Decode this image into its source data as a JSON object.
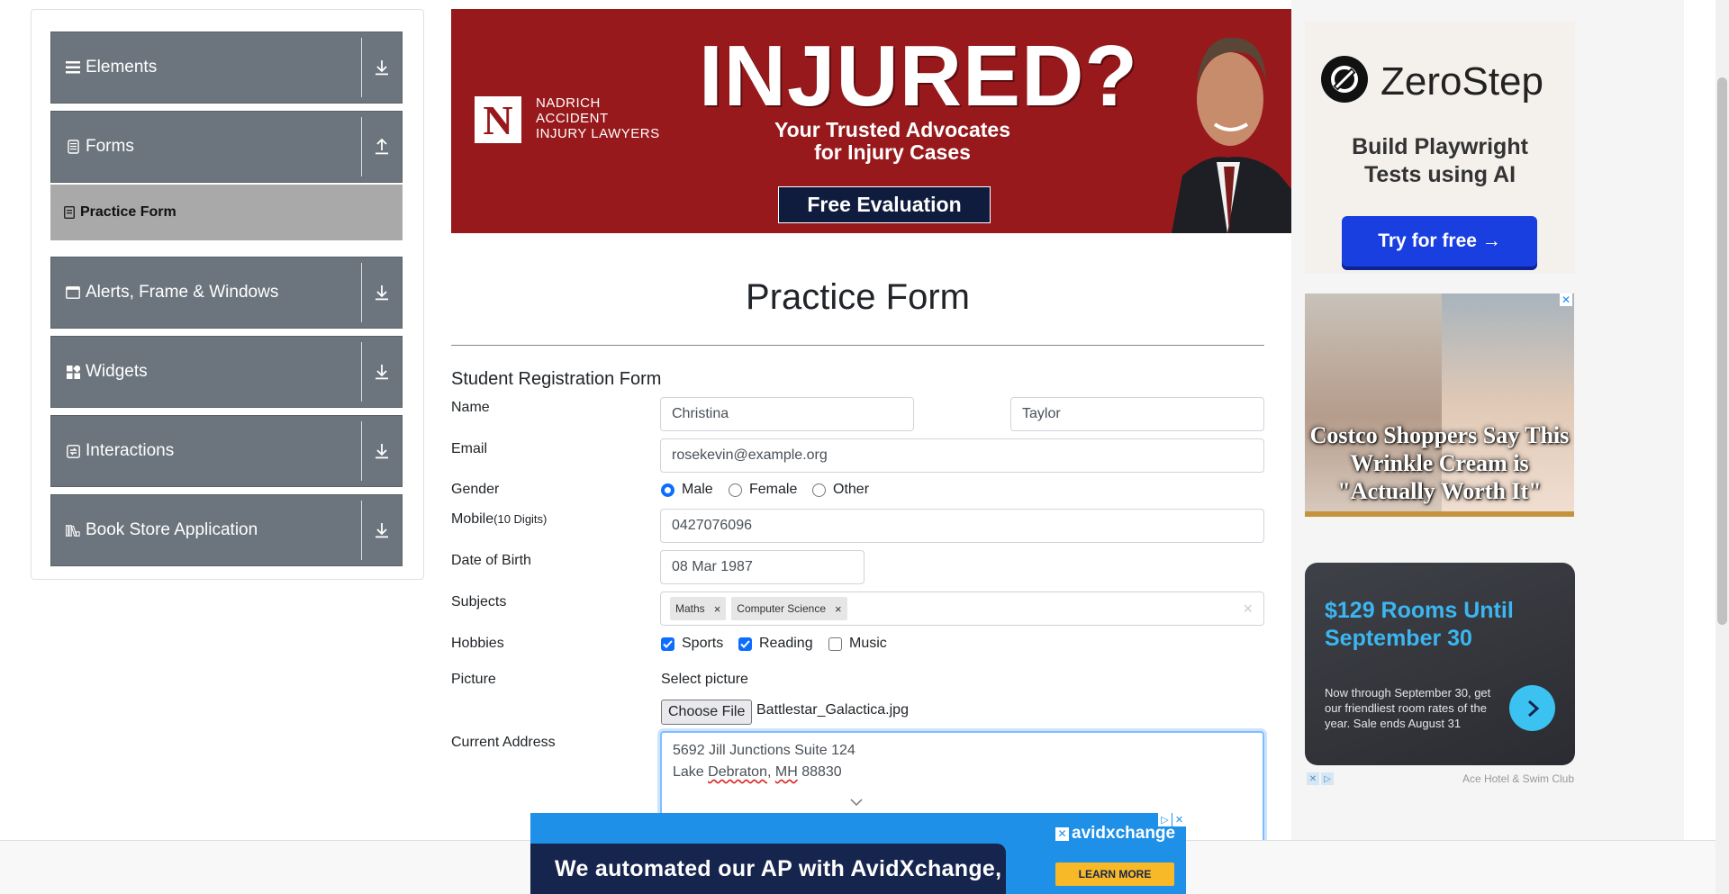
{
  "sidebar": {
    "groups": [
      {
        "label": "Elements",
        "icon": "menu-icon",
        "arrow": "download-icon"
      },
      {
        "label": "Forms",
        "icon": "document-icon",
        "arrow": "upload-icon"
      },
      {
        "label": "Alerts, Frame & Windows",
        "icon": "window-icon",
        "arrow": "download-icon"
      },
      {
        "label": "Widgets",
        "icon": "widgets-icon",
        "arrow": "download-icon"
      },
      {
        "label": "Interactions",
        "icon": "interactions-icon",
        "arrow": "download-icon"
      },
      {
        "label": "Book Store Application",
        "icon": "books-icon",
        "arrow": "download-icon"
      }
    ],
    "active_item": "Practice Form"
  },
  "banner_ad": {
    "firm_lines": [
      "NADRICH",
      "ACCIDENT",
      "INJURY LAWYERS"
    ],
    "logo_letter": "N",
    "headline": "INJURED?",
    "tagline_1": "Your Trusted Advocates",
    "tagline_2": "for Injury Cases",
    "cta": "Free Evaluation",
    "color": "#98191c"
  },
  "form": {
    "page_title": "Practice Form",
    "subtitle": "Student Registration Form",
    "labels": {
      "name": "Name",
      "email": "Email",
      "gender": "Gender",
      "mobile": "Mobile",
      "mobile_hint": "(10 Digits)",
      "dob": "Date of Birth",
      "subjects": "Subjects",
      "hobbies": "Hobbies",
      "picture": "Picture",
      "address": "Current Address"
    },
    "first_name": "Christina",
    "last_name": "Taylor",
    "email": "rosekevin@example.org",
    "gender_options": [
      {
        "label": "Male",
        "checked": true
      },
      {
        "label": "Female",
        "checked": false
      },
      {
        "label": "Other",
        "checked": false
      }
    ],
    "mobile": "0427076096",
    "dob": "08 Mar 1987",
    "subjects": [
      "Maths",
      "Computer Science"
    ],
    "hobbies": [
      {
        "label": "Sports",
        "checked": true
      },
      {
        "label": "Reading",
        "checked": true
      },
      {
        "label": "Music",
        "checked": false
      }
    ],
    "picture_label": "Select picture",
    "choose_file": "Choose File",
    "file_name": "Battlestar_Galactica.jpg",
    "address_line_1": "5692 Jill Junctions Suite 124",
    "address_line_2_a": "Lake ",
    "address_line_2_b": "Debraton",
    "address_line_2_c": ", ",
    "address_line_2_d": "MH",
    "address_line_2_e": " 88830",
    "accent": "#0d6efd"
  },
  "right_ads": {
    "zerostep": {
      "brand": "ZeroStep",
      "line1": "Build Playwright",
      "line2": "Tests using AI",
      "cta": "Try for free →"
    },
    "costco": {
      "line1": "Costco Shoppers Say This",
      "line2": "Wrinkle Cream is",
      "line3": "\"Actually Worth It\""
    },
    "hotel": {
      "headline": "$129 Rooms Until September 30",
      "body": "Now through September 30, get our friendliest room rates of the year. Sale ends August 31",
      "advertiser": "Ace Hotel & Swim Club"
    }
  },
  "bottom_ad": {
    "text": "We automated our AP with AvidXchange,",
    "brand": "avidxchange",
    "cta": "LEARN MORE"
  }
}
